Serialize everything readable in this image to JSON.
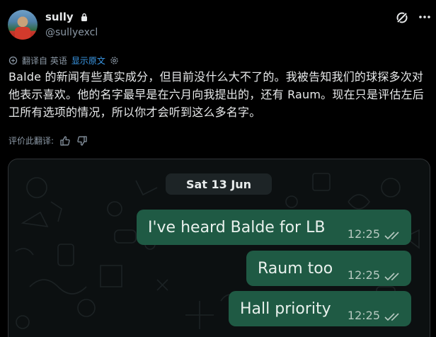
{
  "header": {
    "display_name": "sully",
    "handle": "@sullyexcl",
    "icons": [
      "lock-icon",
      "grok-icon",
      "more-icon"
    ]
  },
  "translation": {
    "label": "翻译自 英语",
    "show_original": "显示原文",
    "icons": [
      "translate-icon",
      "settings-icon"
    ]
  },
  "post": {
    "text": "Balde 的新闻有些真实成分，但目前没什么大不了的。我被告知我们的球探多次对他表示喜欢。他的名字最早是在六月向我提出的，还有 Raum。现在只是评估左后卫所有选项的情况，所以你才会听到这么多名字。"
  },
  "rating": {
    "label": "评价此翻译:",
    "icons": [
      "thumbs-up-icon",
      "thumbs-down-icon"
    ]
  },
  "chat": {
    "date": "Sat 13 Jun",
    "messages": [
      {
        "text": "I've heard Balde for LB",
        "time": "12:25"
      },
      {
        "text": "Raum too",
        "time": "12:25"
      },
      {
        "text": "Hall priority",
        "time": "12:25"
      }
    ]
  },
  "colors": {
    "background": "#000000",
    "link": "#3b9ae9",
    "bubble": "#1f5a44",
    "muted": "#8b98a5"
  }
}
